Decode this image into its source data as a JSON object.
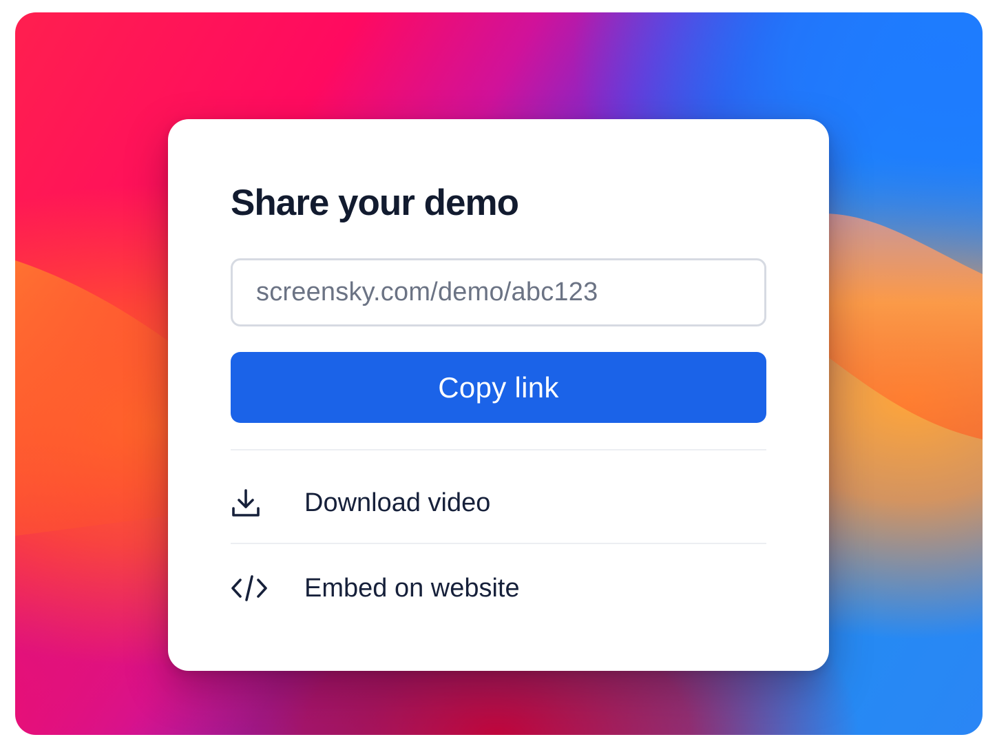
{
  "dialog": {
    "title": "Share your demo",
    "share_url": "screensky.com/demo/abc123",
    "copy_button_label": "Copy link",
    "options": [
      {
        "label": "Download video",
        "icon": "download-icon"
      },
      {
        "label": "Embed on website",
        "icon": "code-icon"
      }
    ]
  },
  "colors": {
    "primary_button": "#1b63e8",
    "title_text": "#121b2f",
    "url_text": "#6b7384",
    "field_border": "#d6dae2"
  }
}
